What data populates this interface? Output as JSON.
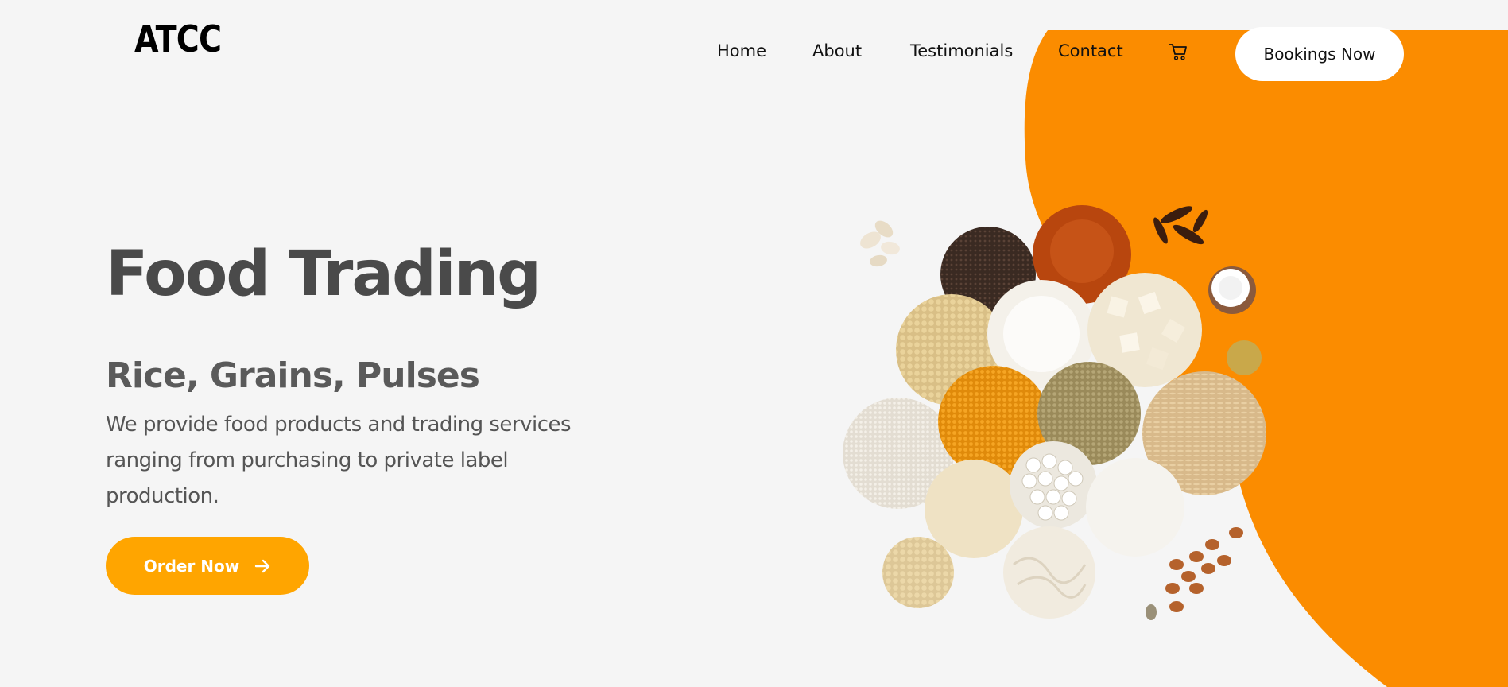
{
  "brand": {
    "logo_text": "ATCC"
  },
  "nav": {
    "items": [
      {
        "label": "Home"
      },
      {
        "label": "About"
      },
      {
        "label": "Testimonials"
      },
      {
        "label": "Contact"
      }
    ],
    "cart_icon": "shopping-cart-icon",
    "bookings_label": "Bookings Now"
  },
  "hero": {
    "title": "Food Trading",
    "subtitle": "Rice, Grains, Pulses",
    "description": "We provide food products and trading services ranging from purchasing to private label production.",
    "cta_label": "Order Now",
    "cta_icon": "arrow-right-icon",
    "image_subject": "spices-grains-pulses-image"
  },
  "colors": {
    "background": "#f5f5f5",
    "accent_orange": "#fb8c00",
    "cta_yellow": "#ffa500",
    "title_gray": "#4a4a4a",
    "text_gray": "#555555"
  }
}
